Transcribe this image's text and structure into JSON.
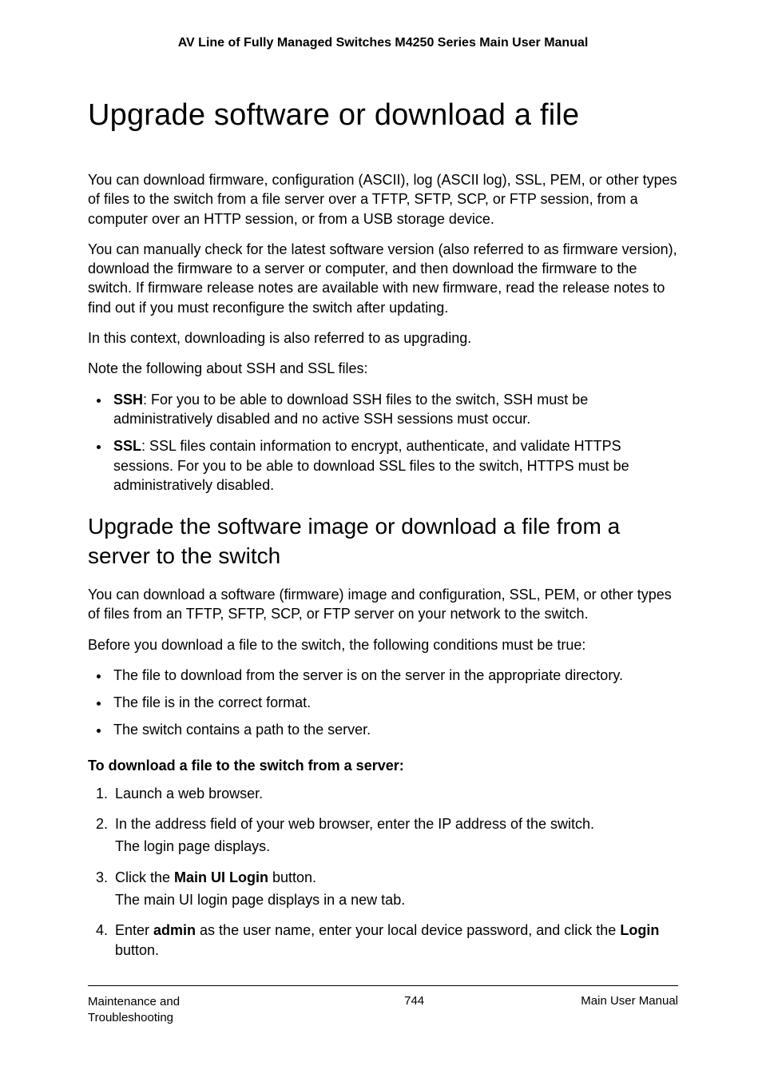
{
  "header": {
    "title": "AV Line of Fully Managed Switches M4250 Series Main User Manual"
  },
  "h1": "Upgrade software or download a file",
  "para1": "You can download firmware, configuration (ASCII), log (ASCII log), SSL, PEM, or other types of files to the switch from a file server over a TFTP, SFTP, SCP, or FTP session, from a computer over an HTTP session, or from a USB storage device.",
  "para2": "You can manually check for the latest software version (also referred to as firmware version), download the firmware to a server or computer, and then download the firmware to the switch. If firmware release notes are available with new firmware, read the release notes to find out if you must reconfigure the switch after updating.",
  "para3": "In this context, downloading is also referred to as upgrading.",
  "para4": "Note the following about SSH and SSL files:",
  "bullets1": [
    {
      "term": "SSH",
      "text": ": For you to be able to download SSH files to the switch, SSH must be administratively disabled and no active SSH sessions must occur."
    },
    {
      "term": "SSL",
      "text": ": SSL files contain information to encrypt, authenticate, and validate HTTPS sessions. For you to be able to download SSL files to the switch, HTTPS must be administratively disabled."
    }
  ],
  "h2": "Upgrade the software image or download a file from a server to the switch",
  "para5": "You can download a software (firmware) image and configuration, SSL, PEM, or other types of files from an TFTP, SFTP, SCP, or FTP server on your network to the switch.",
  "para6": "Before you download a file to the switch, the following conditions must be true:",
  "bullets2": [
    "The file to download from the server is on the server in the appropriate directory.",
    "The file is in the correct format.",
    "The switch contains a path to the server."
  ],
  "procTitle": "To download a file to the switch from a server:",
  "steps": {
    "s1": "Launch a web browser.",
    "s2_main": "In the address field of your web browser, enter the IP address of the switch.",
    "s2_sub": "The login page displays.",
    "s3_pre": "Click the ",
    "s3_bold": "Main UI Login",
    "s3_post": " button.",
    "s3_sub": "The main UI login page displays in a new tab.",
    "s4_pre": "Enter ",
    "s4_b1": "admin",
    "s4_mid": " as the user name, enter your local device password, and click the ",
    "s4_b2": "Login",
    "s4_post": " button."
  },
  "footer": {
    "left": "Maintenance and Troubleshooting",
    "center": "744",
    "right": "Main User Manual"
  }
}
